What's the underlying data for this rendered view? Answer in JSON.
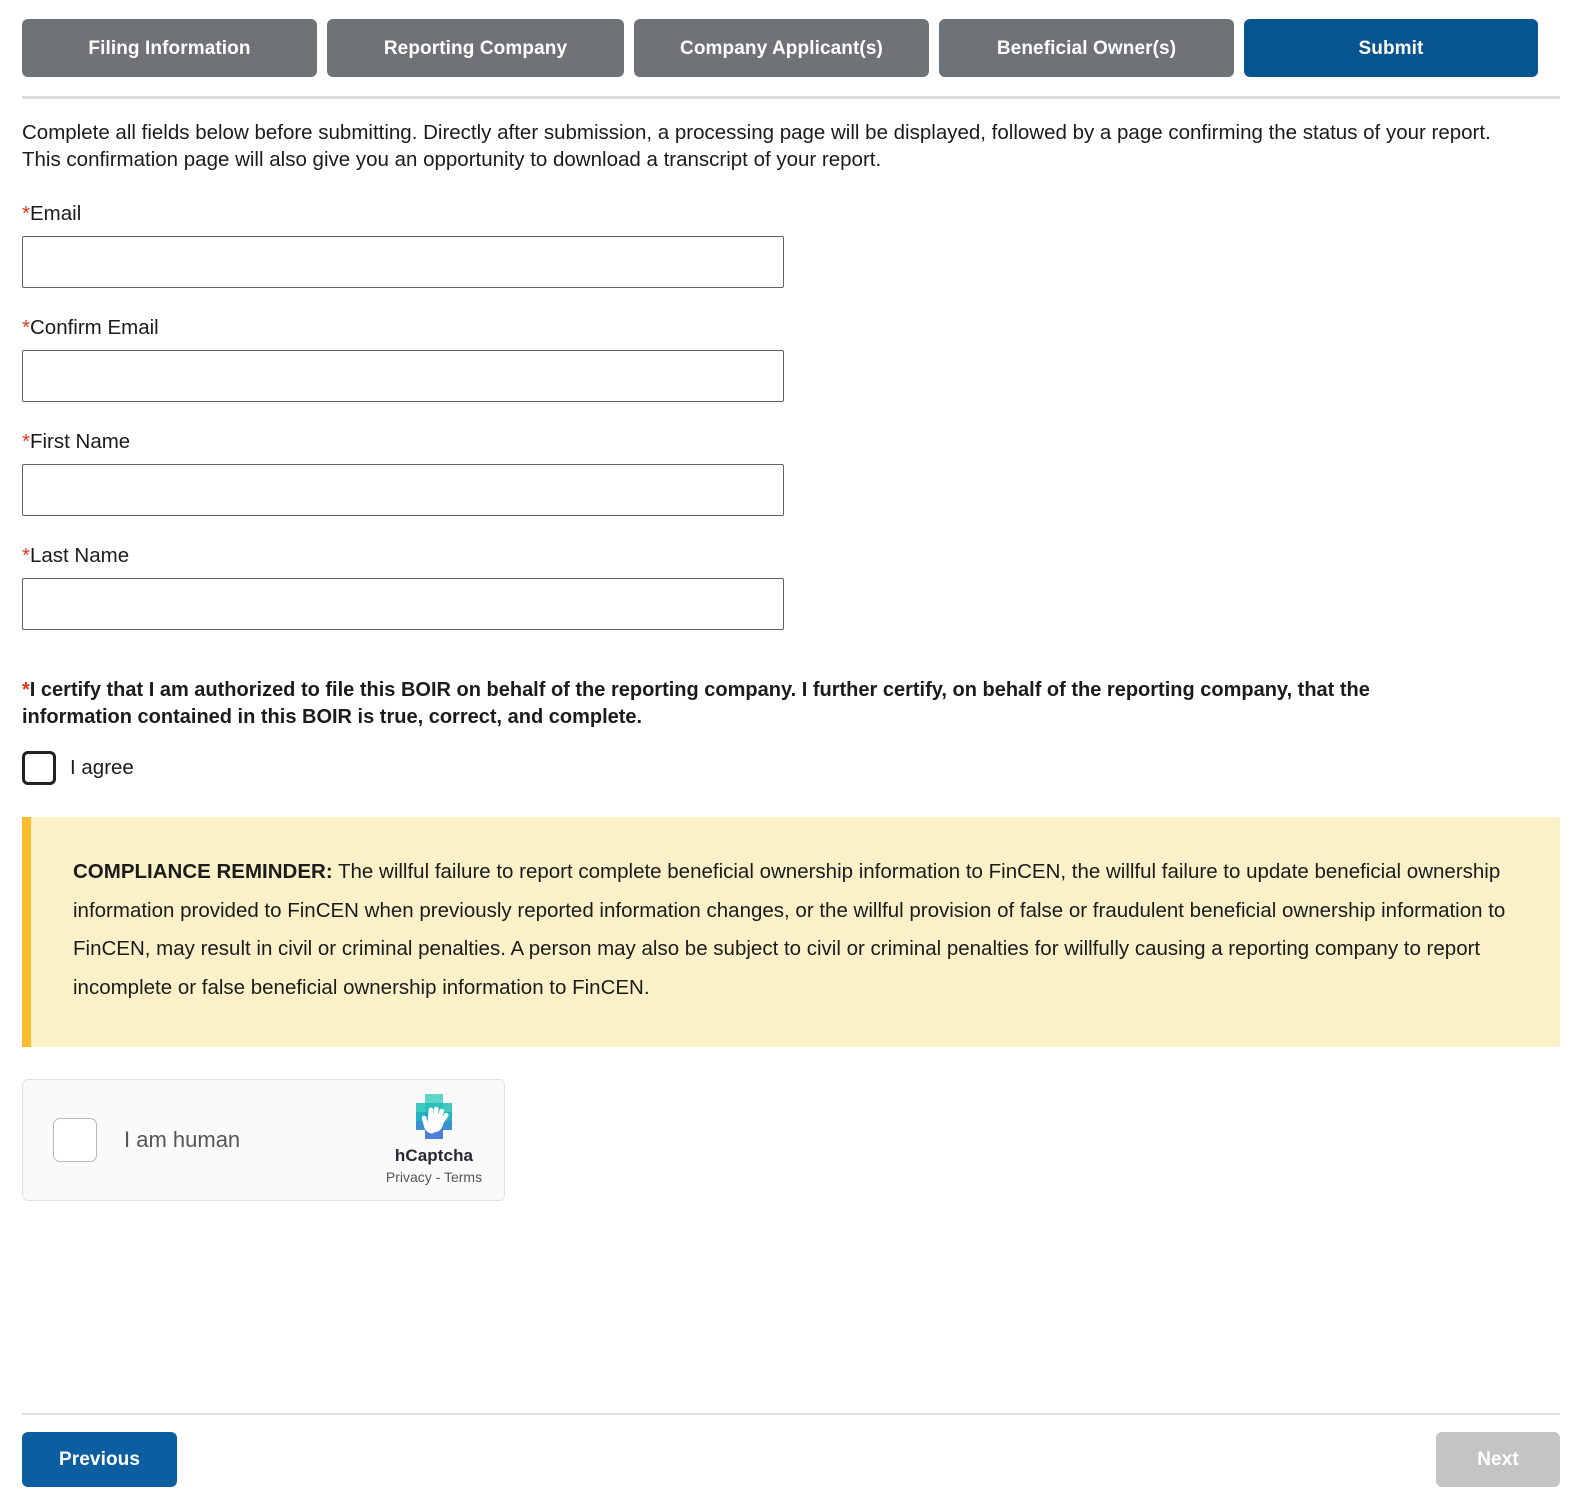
{
  "tabs": [
    {
      "label": "Filing Information",
      "state": "inactive"
    },
    {
      "label": "Reporting Company",
      "state": "inactive"
    },
    {
      "label": "Company Applicant(s)",
      "state": "inactive"
    },
    {
      "label": "Beneficial Owner(s)",
      "state": "inactive"
    },
    {
      "label": "Submit",
      "state": "active"
    }
  ],
  "intro": "Complete all fields below before submitting. Directly after submission, a processing page will be displayed, followed by a page confirming the status of your report. This confirmation page will also give you an opportunity to download a transcript of your report.",
  "fields": [
    {
      "label": "Email",
      "required_marker": "*",
      "value": "",
      "placeholder": ""
    },
    {
      "label": "Confirm Email",
      "required_marker": "*",
      "value": "",
      "placeholder": ""
    },
    {
      "label": "First Name",
      "required_marker": "*",
      "value": "",
      "placeholder": ""
    },
    {
      "label": "Last Name",
      "required_marker": "*",
      "value": "",
      "placeholder": ""
    }
  ],
  "certification": {
    "required_marker": "*",
    "text": "I certify that I am authorized to file this BOIR on behalf of the reporting company. I further certify, on behalf of the reporting company, that the information contained in this BOIR is true, correct, and complete.",
    "agree_label": "I agree",
    "checked": false
  },
  "compliance": {
    "heading": "COMPLIANCE REMINDER:",
    "body": " The willful failure to report complete beneficial ownership information to FinCEN, the willful failure to update beneficial ownership information provided to FinCEN when previously reported information changes, or the willful provision of false or fraudulent beneficial ownership information to FinCEN, may result in civil or criminal penalties. A person may also be subject to civil or criminal penalties for willfully causing a reporting company to report incomplete or false beneficial ownership information to FinCEN.",
    "bg_color": "#faf1c8",
    "accent_color": "#fcbc2c"
  },
  "captcha": {
    "checkbox_label": "I am human",
    "brand": "hCaptcha",
    "legal": "Privacy - Terms",
    "checked": false
  },
  "footer": {
    "previous_label": "Previous",
    "next_label": "Next",
    "next_disabled": true
  },
  "colors": {
    "tab_inactive": "#6f7376",
    "tab_active": "#07558F",
    "primary_button": "#0b5ea0",
    "disabled_button": "#c4c4c4",
    "required_asterisk": "#e8341c"
  }
}
